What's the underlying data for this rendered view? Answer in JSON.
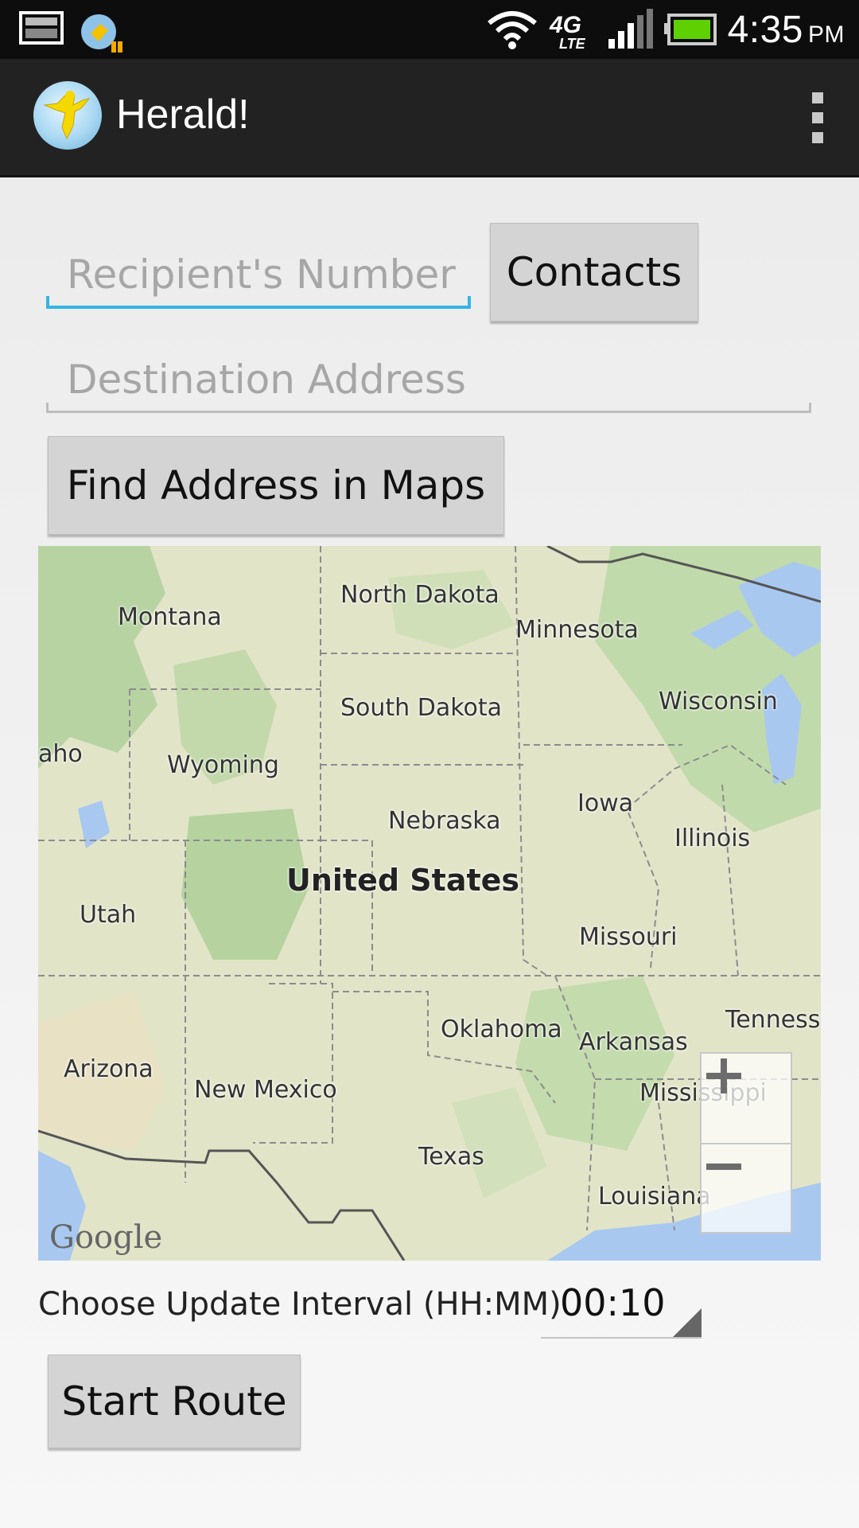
{
  "status_bar": {
    "time": "4:35",
    "ampm": "PM",
    "network_label": "4G LTE",
    "icons": [
      "screenshot-icon",
      "app-notification-icon",
      "wifi-icon",
      "4g-lte-icon",
      "signal-icon",
      "battery-icon"
    ]
  },
  "action_bar": {
    "title": "Herald!",
    "app_icon": "herald-angel-icon",
    "overflow_icon": "overflow-menu-icon"
  },
  "form": {
    "recipient_placeholder": "Recipient's Number",
    "recipient_value": "",
    "contacts_button": "Contacts",
    "destination_placeholder": "Destination Address",
    "destination_value": "",
    "find_button": "Find Address in Maps",
    "interval_label": "Choose Update Interval (HH:MM)",
    "interval_value": "00:10",
    "start_button": "Start Route"
  },
  "map": {
    "country_label": "United States",
    "labels": [
      "North Dakota",
      "Minnesota",
      "Montana",
      "Wisconsin",
      "South Dakota",
      "aho",
      "Wyoming",
      "Iowa",
      "Nebraska",
      "Illinois",
      "Utah",
      "Missouri",
      "Tenness",
      "Oklahoma",
      "Arkansas",
      "Arizona",
      "New Mexico",
      "Mississippi",
      "Texas",
      "Louisiana"
    ],
    "zoom_in": "+",
    "zoom_out": "−",
    "attribution": "Google",
    "colors": {
      "land": "#dfe3c6",
      "forest": "#b9d6a6",
      "water": "#a8c8f0",
      "border": "#8a8a8a"
    }
  },
  "colors": {
    "accent": "#33b5e5",
    "action_bar": "#222222",
    "button": "#d4d4d4",
    "background": "#f0f0f0"
  }
}
